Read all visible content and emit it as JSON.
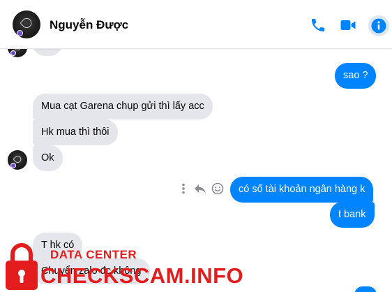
{
  "header": {
    "contact_name": "Nguyễn Được",
    "accent_color": "#0084ff",
    "icons": [
      "phone-icon",
      "video-icon",
      "info-icon"
    ]
  },
  "messages": [
    {
      "side": "in",
      "text": ""
    },
    {
      "side": "out",
      "text": "sao ?"
    },
    {
      "side": "in",
      "text": "Mua cạt Garena chụp gửi thì lấy acc"
    },
    {
      "side": "in",
      "text": "Hk mua thì thôi"
    },
    {
      "side": "in",
      "text": "Ok"
    },
    {
      "side": "out",
      "text": "có số tài khoản ngân hàng k"
    },
    {
      "side": "out",
      "text": "t bank"
    },
    {
      "side": "in",
      "text": "T hk có"
    },
    {
      "side": "in",
      "text": "Chuyển zalo đc không"
    },
    {
      "side": "out",
      "text": ""
    }
  ],
  "message_actions": [
    "more-icon",
    "reply-icon",
    "react-icon"
  ],
  "watermark": {
    "line1": "DATA CENTER",
    "line2": "CHECKSCAM.INFO",
    "color": "#e31d1d"
  }
}
